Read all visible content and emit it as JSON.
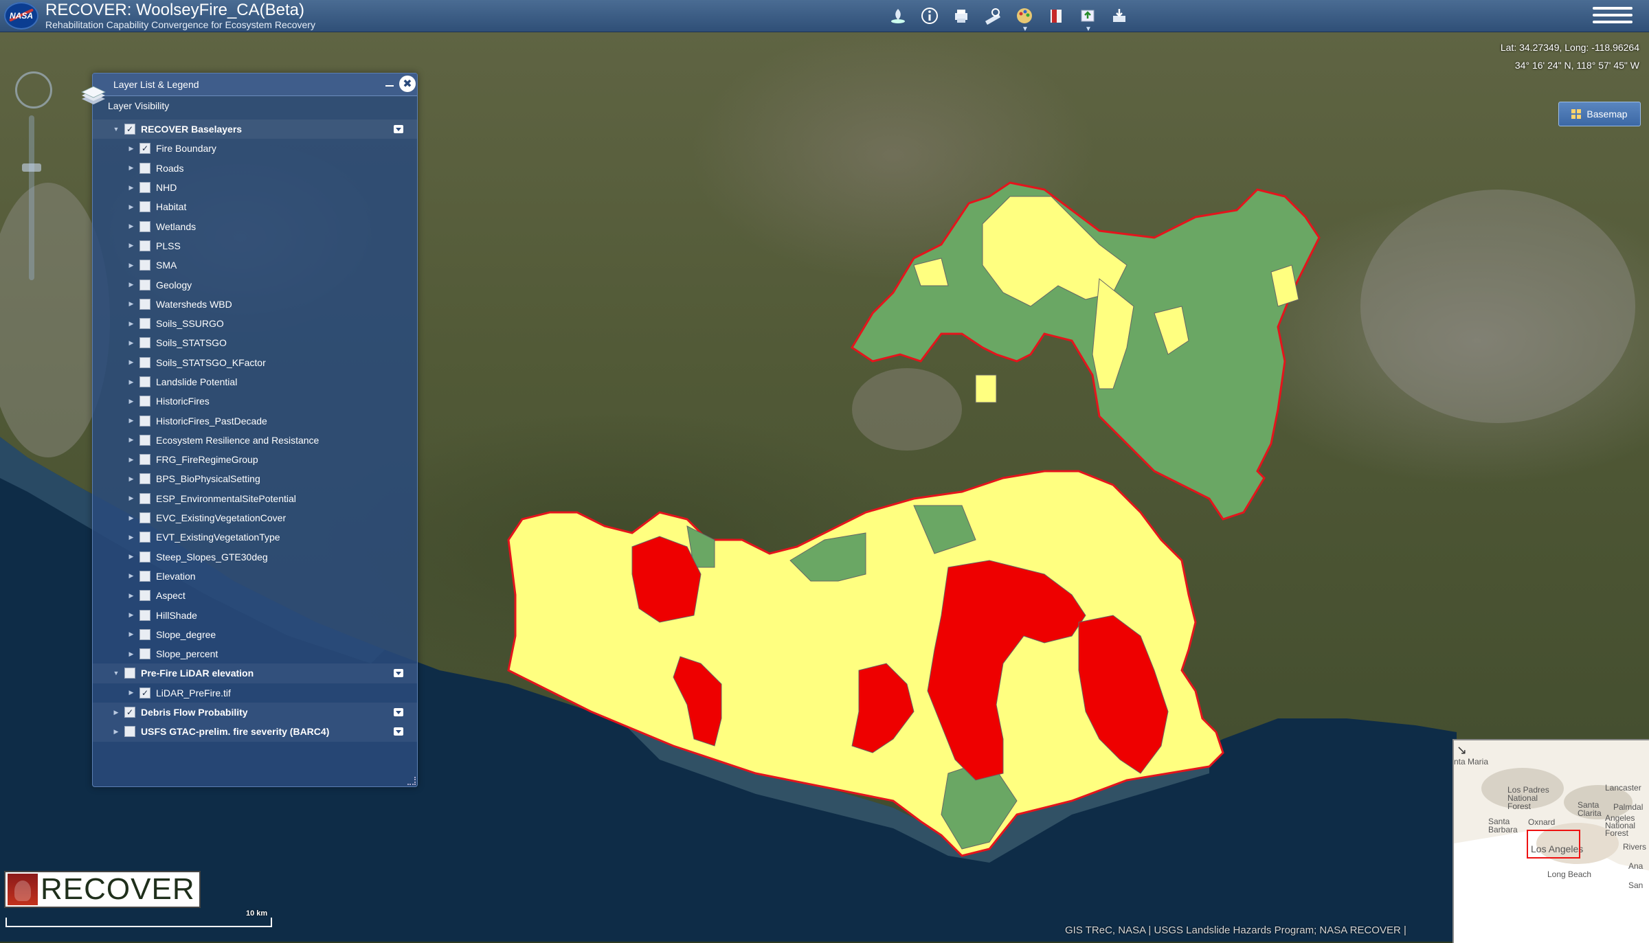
{
  "app": {
    "logo_text": "NASA",
    "title": "RECOVER: WoolseyFire_CA(Beta)",
    "subtitle": "Rehabilitation Capability Convergence for Ecosystem Recovery"
  },
  "toolbar": {
    "icons": [
      "fire-icon",
      "info-icon",
      "print-icon",
      "measure-icon",
      "color-palette-icon",
      "bookmark-icon",
      "upload-icon",
      "download-icon"
    ]
  },
  "coordinates": {
    "decimal": "Lat: 34.27349, Long: -118.96264",
    "dms": "34° 16' 24\" N, 118° 57' 45\" W"
  },
  "basemap": {
    "label": "Basemap"
  },
  "layer_panel": {
    "title": "Layer List & Legend",
    "close_symbol": "✖",
    "visibility_label": "Layer Visibility",
    "layers": [
      {
        "label": "RECOVER Baselayers",
        "type": "group",
        "checked": true,
        "menu": true
      },
      {
        "label": "Fire Boundary",
        "type": "child",
        "checked": true
      },
      {
        "label": "Roads",
        "type": "child",
        "checked": false
      },
      {
        "label": "NHD",
        "type": "child",
        "checked": false
      },
      {
        "label": "Habitat",
        "type": "child",
        "checked": false
      },
      {
        "label": "Wetlands",
        "type": "child",
        "checked": false
      },
      {
        "label": "PLSS",
        "type": "child",
        "checked": false
      },
      {
        "label": "SMA",
        "type": "child",
        "checked": false
      },
      {
        "label": "Geology",
        "type": "child",
        "checked": false
      },
      {
        "label": "Watersheds WBD",
        "type": "child",
        "checked": false
      },
      {
        "label": "Soils_SSURGO",
        "type": "child",
        "checked": false
      },
      {
        "label": "Soils_STATSGO",
        "type": "child",
        "checked": false
      },
      {
        "label": "Soils_STATSGO_KFactor",
        "type": "child",
        "checked": false
      },
      {
        "label": "Landslide Potential",
        "type": "child",
        "checked": false
      },
      {
        "label": "HistoricFires",
        "type": "child",
        "checked": false
      },
      {
        "label": "HistoricFires_PastDecade",
        "type": "child",
        "checked": false
      },
      {
        "label": "Ecosystem Resilience and Resistance",
        "type": "child",
        "checked": false
      },
      {
        "label": "FRG_FireRegimeGroup",
        "type": "child",
        "checked": false
      },
      {
        "label": "BPS_BioPhysicalSetting",
        "type": "child",
        "checked": false
      },
      {
        "label": "ESP_EnvironmentalSitePotential",
        "type": "child",
        "checked": false
      },
      {
        "label": "EVC_ExistingVegetationCover",
        "type": "child",
        "checked": false
      },
      {
        "label": "EVT_ExistingVegetationType",
        "type": "child",
        "checked": false
      },
      {
        "label": "Steep_Slopes_GTE30deg",
        "type": "child",
        "checked": false
      },
      {
        "label": "Elevation",
        "type": "child",
        "checked": false
      },
      {
        "label": "Aspect",
        "type": "child",
        "checked": false
      },
      {
        "label": "HillShade",
        "type": "child",
        "checked": false
      },
      {
        "label": "Slope_degree",
        "type": "child",
        "checked": false
      },
      {
        "label": "Slope_percent",
        "type": "child",
        "checked": false
      },
      {
        "label": "Pre-Fire LiDAR elevation",
        "type": "group",
        "checked": false,
        "menu": true
      },
      {
        "label": "LiDAR_PreFire.tif",
        "type": "child",
        "checked": true
      },
      {
        "label": "Debris Flow Probability",
        "type": "group",
        "checked": true,
        "menu": true
      },
      {
        "label": "USFS GTAC-prelim. fire severity (BARC4)",
        "type": "group",
        "checked": false,
        "menu": true
      }
    ]
  },
  "map_colors": {
    "fire_boundary": "#e4141c",
    "high": "#ee0000",
    "moderate": "#ffff80",
    "low": "#6aa764"
  },
  "logo": {
    "text": "RECOVER"
  },
  "scale": {
    "label": "10 km"
  },
  "attribution": "GIS TReC, NASA | USGS Landslide Hazards Program; NASA RECOVER |",
  "overview_map": {
    "places": [
      "nta Maria",
      "Los Padres National Forest",
      "Lancaster",
      "Santa Clarita",
      "Palmdal",
      "Angeles National Forest",
      "Santa Barbara",
      "Oxnard",
      "Los Angeles",
      "Rivers",
      "Ana",
      "Long Beach",
      "San"
    ]
  }
}
